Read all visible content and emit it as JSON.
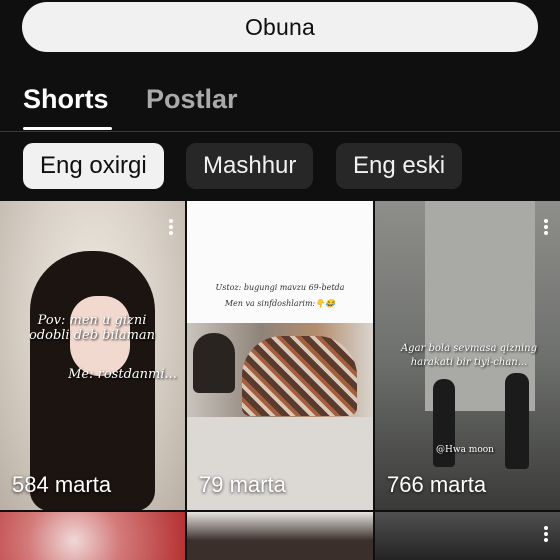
{
  "subscribe_button": {
    "label": "Obuna"
  },
  "tabs": [
    {
      "label": "Shorts",
      "active": true
    },
    {
      "label": "Postlar",
      "active": false
    }
  ],
  "filters": [
    {
      "label": "Eng oxirgi",
      "selected": true
    },
    {
      "label": "Mashhur",
      "selected": false
    },
    {
      "label": "Eng eski",
      "selected": false
    }
  ],
  "shorts": [
    {
      "views": "584 marta",
      "caption_lines": [
        "Pov: men u gizni",
        "odobli deb bilaman"
      ],
      "caption2": "Me: rostdanmi..."
    },
    {
      "views": "79 marta",
      "caption_lines": [
        "Ustoz: bugungi mavzu 69-betda",
        "Men va sinfdoshlarim:👇😂"
      ]
    },
    {
      "views": "766 marta",
      "caption_lines": [
        "Agar bola sevmasa qizning",
        "harakati bir tiyi-chan..."
      ],
      "watermark": "@Hwa moon"
    }
  ]
}
